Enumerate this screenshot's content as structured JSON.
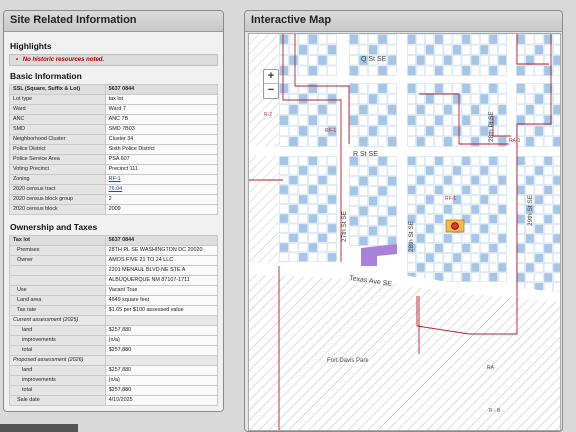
{
  "site": {
    "title": "Site Related Information",
    "highlights_title": "Highlights",
    "highlight_text": "No historic resources noted.",
    "basic_title": "Basic Information",
    "basic_rows": [
      {
        "k": "SSL (Square, Suffix & Lot)",
        "v": "5637 0844",
        "hdr": true
      },
      {
        "k": "Lot type",
        "v": "tax lot"
      },
      {
        "k": "Ward",
        "v": "Ward 7"
      },
      {
        "k": "ANC",
        "v": "ANC 7B"
      },
      {
        "k": "SMD",
        "v": "SMD 7B03"
      },
      {
        "k": "Neighborhood Cluster",
        "v": "Cluster 34"
      },
      {
        "k": "Police District",
        "v": "Sixth Police District"
      },
      {
        "k": "Police Service Area",
        "v": "PSA 607"
      },
      {
        "k": "Voting Precinct",
        "v": "Precinct 111"
      },
      {
        "k": "Zoning",
        "v": "RF-1",
        "link": true
      },
      {
        "k": "2020 census tract",
        "v": "76.04",
        "link": true
      },
      {
        "k": "2020 census block group",
        "v": "2"
      },
      {
        "k": "2020 census block",
        "v": "2009"
      }
    ],
    "ownership_title": "Ownership and Taxes",
    "tax_rows": [
      {
        "k": "Tax lot",
        "v": "5637 0844",
        "hdr": true
      },
      {
        "k": "Premises",
        "v": "28TH PL SE WASHINGTON DC 20020",
        "ind": 1
      },
      {
        "k": "Owner",
        "v": "AMOS FIVE 21 TO 24 LLC",
        "ind": 1
      },
      {
        "k": "",
        "v": "2201 MENAUL BLVD NE STE A"
      },
      {
        "k": "",
        "v": "ALBUQUERQUE NM 87107-1711"
      },
      {
        "k": "Use",
        "v": "Vacant True",
        "ind": 1
      },
      {
        "k": "Land area",
        "v": "4649 square feet",
        "ind": 1
      },
      {
        "k": "Tax rate",
        "v": "$1.65 per $100 assessed value",
        "ind": 1
      },
      {
        "k": "Current assessment (2025)",
        "v": "",
        "sub": true
      },
      {
        "k": "land",
        "v": "$257,880",
        "ind": 2
      },
      {
        "k": "improvements",
        "v": "(n/a)",
        "ind": 2
      },
      {
        "k": "total",
        "v": "$257,880",
        "ind": 2
      },
      {
        "k": "Proposed assessment (2026)",
        "v": "",
        "sub": true
      },
      {
        "k": "land",
        "v": "$257,880",
        "ind": 2
      },
      {
        "k": "improvements",
        "v": "(n/a)",
        "ind": 2
      },
      {
        "k": "total",
        "v": "$257,880",
        "ind": 2
      },
      {
        "k": "Sale date",
        "v": "4/10/2025",
        "ind": 1
      }
    ]
  },
  "map": {
    "title": "Interactive Map",
    "zoom_in": "+",
    "zoom_out": "−",
    "labels": {
      "q_st": "Q St SE",
      "r_st": "R St SE",
      "st27": "27th St SE",
      "st28": "28th St SE",
      "pl28": "28th Pl SE",
      "st29": "29th St SE",
      "texas": "Texas Ave SE",
      "park": "Fort Davis Park",
      "rf1a": "RF-1",
      "rf1b": "RF-1",
      "ra1": "RA-1",
      "r2": "R-2",
      "ra": "RA",
      "rb": "R - B"
    }
  },
  "colors": {
    "panel_bg": "#f1f1f1",
    "highlight_red": "#b00000",
    "zoning_line": "#b0222e",
    "parcel_fill": "#c9dcef",
    "building_fill": "#a6c4e4",
    "selected_parcel": "#f5b94d",
    "purple_building": "#a782d8"
  }
}
